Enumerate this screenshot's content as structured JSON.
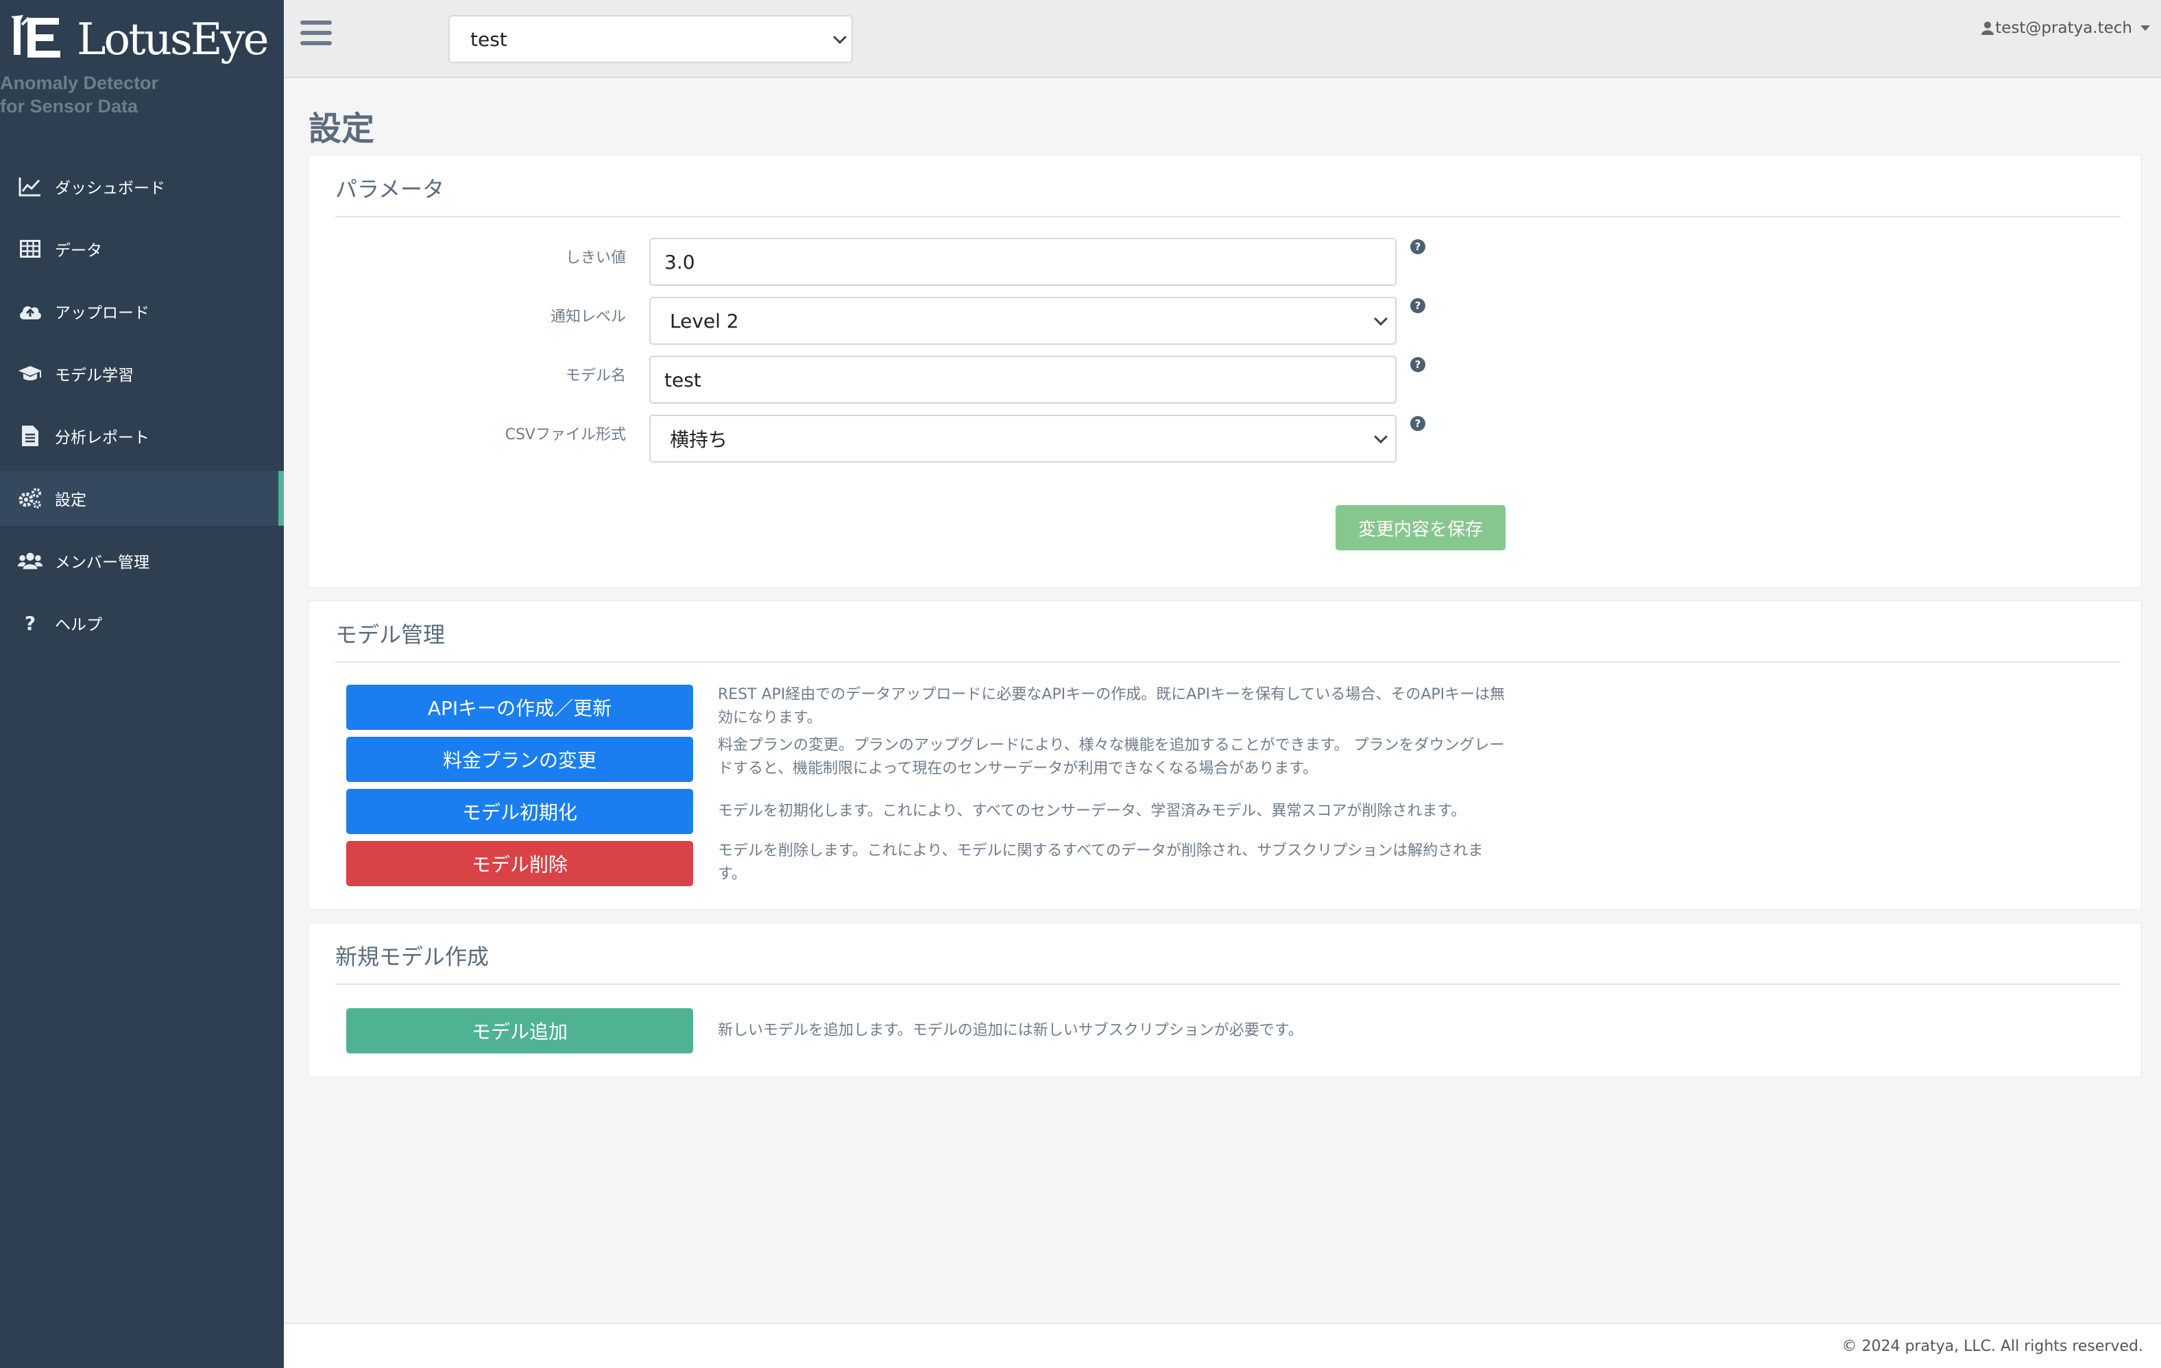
{
  "brand": {
    "name": "LotusEye",
    "tagline_line1": "Anomaly Detector",
    "tagline_line2": "for Sensor Data"
  },
  "sidebar": {
    "items": [
      {
        "label": "ダッシュボード",
        "icon": "line-chart-icon",
        "active": false
      },
      {
        "label": "データ",
        "icon": "table-icon",
        "active": false
      },
      {
        "label": "アップロード",
        "icon": "cloud-upload-icon",
        "active": false
      },
      {
        "label": "モデル学習",
        "icon": "graduation-cap-icon",
        "active": false
      },
      {
        "label": "分析レポート",
        "icon": "file-text-icon",
        "active": false
      },
      {
        "label": "設定",
        "icon": "cogs-icon",
        "active": true
      },
      {
        "label": "メンバー管理",
        "icon": "users-icon",
        "active": false
      },
      {
        "label": "ヘルプ",
        "icon": "question-icon",
        "active": false
      }
    ]
  },
  "topbar": {
    "model_select_value": "test",
    "user_email": "test@pratya.tech"
  },
  "page": {
    "title": "設定"
  },
  "parameters": {
    "title": "パラメータ",
    "fields": [
      {
        "label": "しきい値",
        "value": "3.0",
        "type": "input"
      },
      {
        "label": "通知レベル",
        "value": "Level 2",
        "type": "select"
      },
      {
        "label": "モデル名",
        "value": "test",
        "type": "input"
      },
      {
        "label": "CSVファイル形式",
        "value": "横持ち",
        "type": "select"
      }
    ],
    "help_glyph": "?",
    "save_label": "変更内容を保存"
  },
  "model_management": {
    "title": "モデル管理",
    "actions": [
      {
        "label": "APIキーの作成／更新",
        "desc_line1": "REST API経由でのデータアップロードに必要なAPIキーの作成。既にAPIキーを保有している場合、そのAPIキーは無",
        "desc_line2": "効になります。"
      },
      {
        "label": "料金プランの変更",
        "desc_line1": "料金プランの変更。プランのアップグレードにより、様々な機能を追加することができます。 プランをダウングレー",
        "desc_line2": "ドすると、機能制限によって現在のセンサーデータが利用できなくなる場合があります。"
      },
      {
        "label": "モデル初期化",
        "desc_line1": "モデルを初期化します。これにより、すべてのセンサーデータ、学習済みモデル、異常スコアが削除されます。",
        "desc_line2": ""
      },
      {
        "label": "モデル削除",
        "desc_line1": "モデルを削除します。これにより、モデルに関するすべてのデータが削除され、サブスクリプションは解約されま",
        "desc_line2": "す。"
      }
    ]
  },
  "new_model": {
    "title": "新規モデル作成",
    "button_label": "モデル追加",
    "desc": "新しいモデルを追加します。モデルの追加には新しいサブスクリプションが必要です。"
  },
  "footer": {
    "text": "© 2024 pratya, LLC. All rights reserved."
  },
  "colors": {
    "sidebar_bg": "#2d3f50",
    "active_accent": "#4bb596",
    "primary_blue": "#1a7ef0",
    "danger_red": "#d94246",
    "success_green": "#4fb393",
    "save_green": "#86c78d"
  }
}
